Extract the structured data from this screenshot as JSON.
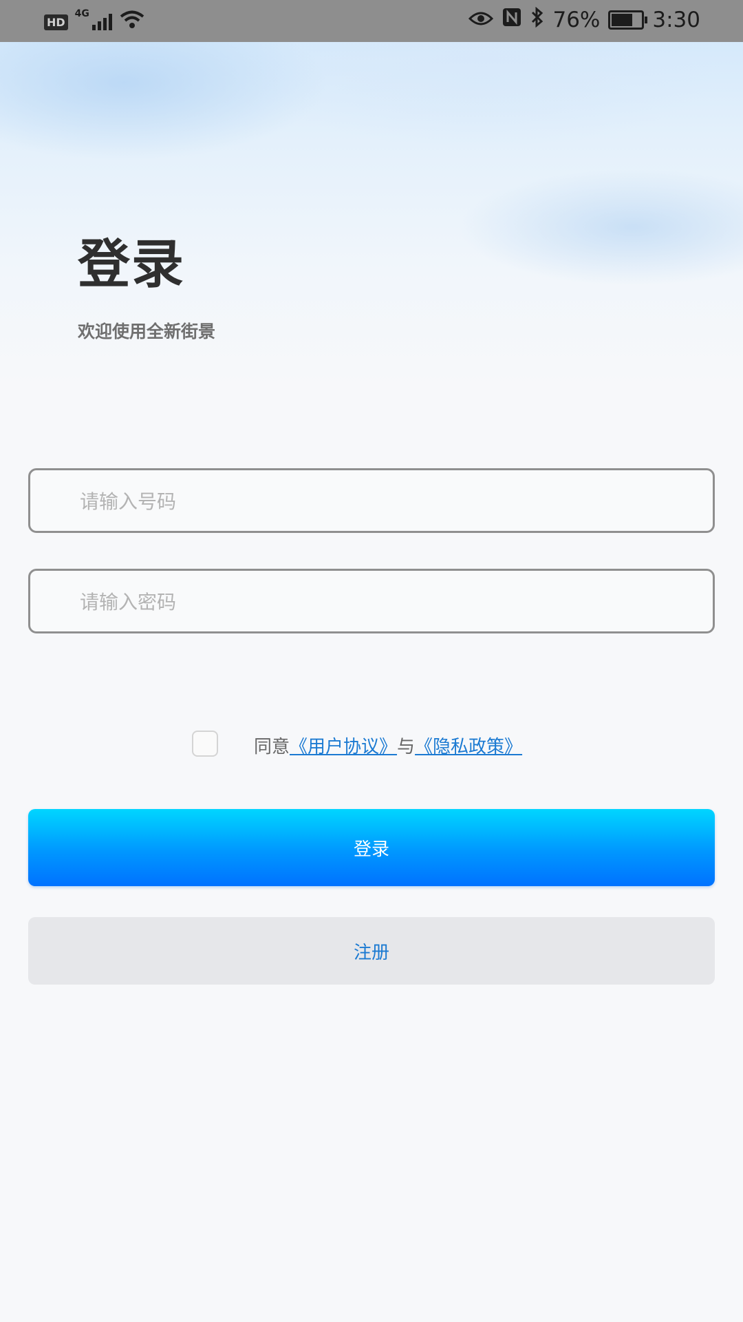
{
  "status_bar": {
    "hd": "HD",
    "network": "4G",
    "battery_percent": "76%",
    "battery_level": 0.76,
    "time": "3:30",
    "icons": [
      "hd-icon",
      "signal-icon",
      "wifi-icon",
      "eye-icon",
      "nfc-icon",
      "bluetooth-icon",
      "battery-icon"
    ]
  },
  "header": {
    "title": "登录",
    "subtitle": "欢迎使用全新街景"
  },
  "form": {
    "phone_placeholder": "请输入号码",
    "phone_value": "",
    "password_placeholder": "请输入密码",
    "password_value": ""
  },
  "agreement": {
    "checked": false,
    "prefix": "同意",
    "user_agreement": "《用户协议》",
    "connector": "与",
    "privacy_policy": "《隐私政策》"
  },
  "buttons": {
    "login": "登录",
    "register": "注册"
  },
  "colors": {
    "status_bar": "#8e8e8e",
    "accent_blue": "#1b7ad2",
    "login_gradient_top": "#00d6ff",
    "login_gradient_bottom": "#0072ff",
    "register_bg": "#e6e7ea"
  }
}
